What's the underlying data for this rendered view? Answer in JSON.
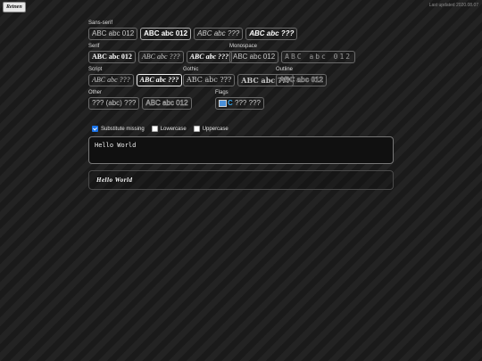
{
  "header": {
    "button_label": "Retnen",
    "last_updated": "Last updated 2020.08.07"
  },
  "sections": {
    "sans": {
      "label": "Sans-serif",
      "options": [
        "ABC abc 012",
        "ABC abc 012",
        "ABC abc ???",
        "ABC abc ???"
      ]
    },
    "serif": {
      "label": "Serif",
      "options": [
        "ABC abc 012",
        "ABC abc ???",
        "ABC abc ???"
      ]
    },
    "mono": {
      "label": "Monospace",
      "options": [
        "ABC abc 012",
        "ABC abc 012"
      ]
    },
    "script": {
      "label": "Script",
      "options": [
        "ABC abc ???",
        "ABC abc ???"
      ]
    },
    "gothic": {
      "label": "Gothic",
      "options": [
        "ABC abc ???",
        "ABC abc ???"
      ]
    },
    "outline": {
      "label": "Outline",
      "options": [
        "ABC abc 012"
      ]
    },
    "other": {
      "label": "Other",
      "options": [
        "??? (abc) ???",
        "ABC abc 012"
      ]
    },
    "flags": {
      "label": "Flags",
      "options": [
        "??? ???"
      ],
      "flag_glyph": "🇸",
      "c_glyph": "C"
    }
  },
  "options": {
    "substitute_missing": "Substitute missing",
    "lowercase": "Lowercase",
    "uppercase": "Uppercase"
  },
  "input": {
    "value": "Hello World"
  },
  "output": {
    "value": "Hello World"
  }
}
